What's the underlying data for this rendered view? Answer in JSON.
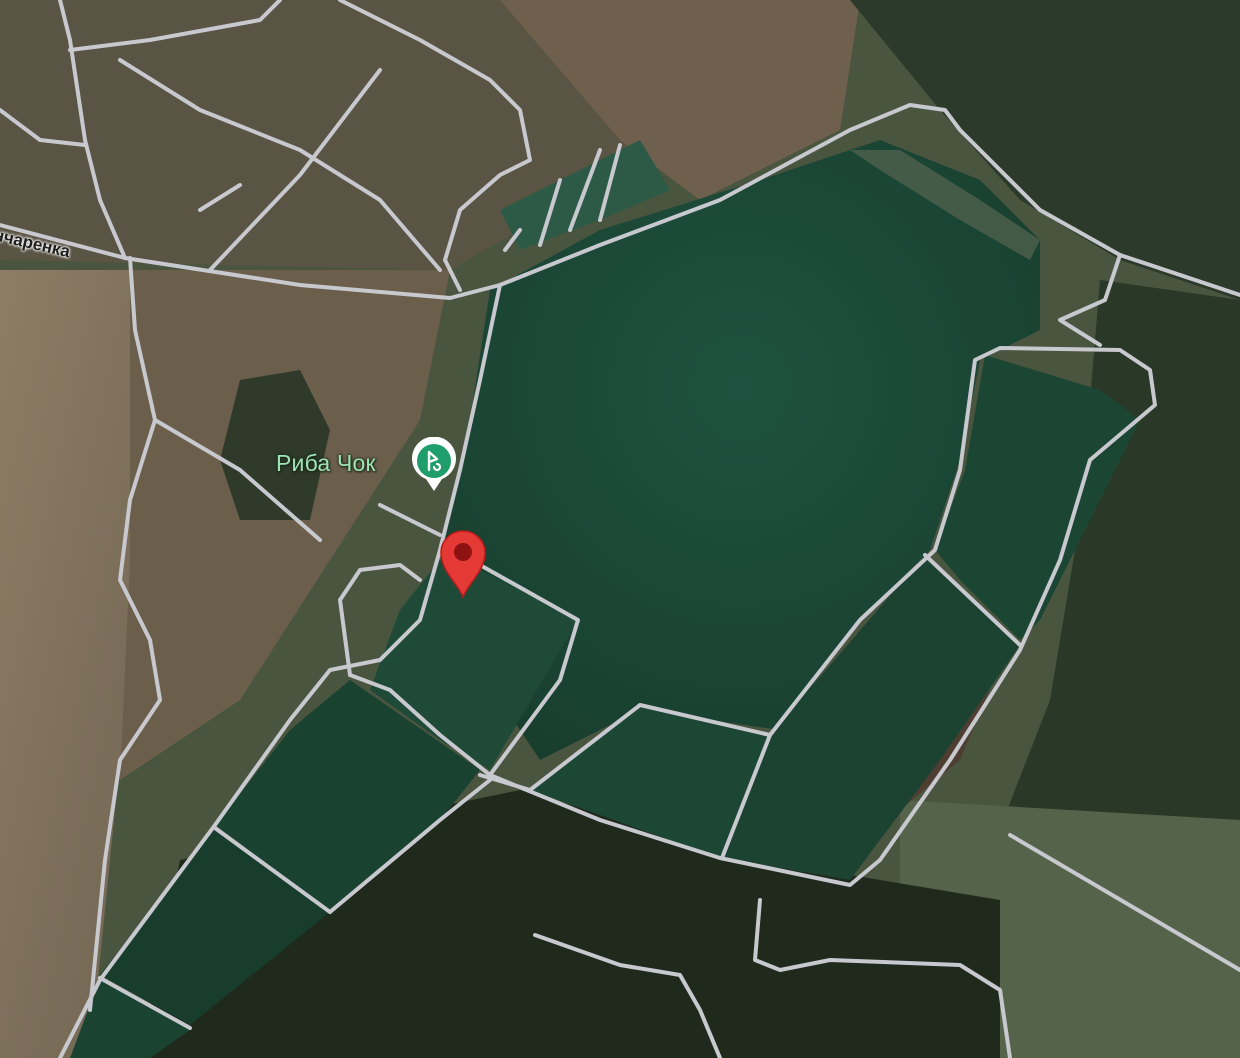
{
  "map": {
    "type": "satellite",
    "poi": {
      "name": "Риба Чок",
      "icon": "fishing-icon",
      "label_color": "#9fe3b4",
      "marker_color": "#1f9d6a"
    },
    "dropped_pin": {
      "icon": "map-pin-icon",
      "color": "#e53935"
    },
    "streets": [
      {
        "name": "нчаренка"
      }
    ],
    "colors": {
      "water": "#1d4a36",
      "forest": "#263524",
      "field": "#7d6e5a",
      "road": "#c9c9cf"
    }
  }
}
